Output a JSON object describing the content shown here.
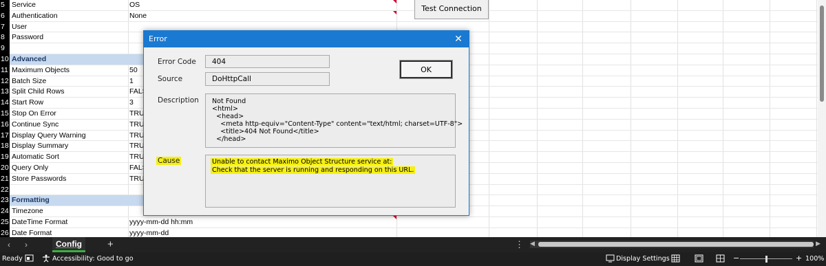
{
  "sheet": {
    "rows": [
      {
        "n": "5",
        "a": "Service",
        "b": "OS"
      },
      {
        "n": "6",
        "a": "Authentication",
        "b": "None"
      },
      {
        "n": "7",
        "a": "User",
        "b": ""
      },
      {
        "n": "8",
        "a": "Password",
        "b": ""
      },
      {
        "n": "9",
        "a": "",
        "b": ""
      },
      {
        "n": "10",
        "a": "Advanced",
        "b": ""
      },
      {
        "n": "11",
        "a": "Maximum Objects",
        "b": "50"
      },
      {
        "n": "12",
        "a": "Batch Size",
        "b": "1"
      },
      {
        "n": "13",
        "a": "Split Child Rows",
        "b": "FALS"
      },
      {
        "n": "14",
        "a": "Start Row",
        "b": "3"
      },
      {
        "n": "15",
        "a": "Stop On Error",
        "b": "TRU"
      },
      {
        "n": "16",
        "a": "Continue Sync",
        "b": "TRU"
      },
      {
        "n": "17",
        "a": "Display Query Warning",
        "b": "TRU"
      },
      {
        "n": "18",
        "a": "Display Summary",
        "b": "TRU"
      },
      {
        "n": "19",
        "a": "Automatic Sort",
        "b": "TRU"
      },
      {
        "n": "20",
        "a": "Query Only",
        "b": "FALS"
      },
      {
        "n": "21",
        "a": "Store Passwords",
        "b": "TRU"
      },
      {
        "n": "22",
        "a": "",
        "b": ""
      },
      {
        "n": "23",
        "a": "Formatting",
        "b": ""
      },
      {
        "n": "24",
        "a": "Timezone",
        "b": ""
      },
      {
        "n": "25",
        "a": "DateTime Format",
        "b": "yyyy-mm-dd hh:mm"
      },
      {
        "n": "26",
        "a": "Date Format",
        "b": "yyyy-mm-dd"
      }
    ],
    "test_connection_label": "Test Connection"
  },
  "dialog": {
    "title": "Error",
    "close_glyph": "✕",
    "ok_label": "OK",
    "error_code_label": "Error Code",
    "error_code_value": "404",
    "source_label": "Source",
    "source_value": "DoHttpCall",
    "description_label": "Description",
    "description_lines": [
      "Not Found",
      "<html>",
      "  <head>",
      "    <meta http-equiv=\"Content-Type\" content=\"text/html; charset=UTF-8\">",
      "    <title>404 Not Found</title>",
      "  </head>"
    ],
    "cause_label": "Cause",
    "cause_lines": [
      "Unable to contact Maximo Object Structure service at:",
      "Check that the server is running and responding on this URL."
    ],
    "highlight_color": "#f5ef13"
  },
  "tabs": {
    "prev_glyph": "‹",
    "next_glyph": "›",
    "active_sheet": "Config",
    "add_glyph": "+",
    "more_glyph": "⋮"
  },
  "status": {
    "ready": "Ready",
    "accessibility": "Accessibility: Good to go",
    "display_settings": "Display Settings",
    "zoom_minus": "−",
    "zoom_plus": "+",
    "zoom": "100%"
  },
  "colors": {
    "section_fill": "#c6d9ef",
    "dialog_title_bar": "#1a79d1",
    "active_tab_underline": "#3db043"
  }
}
